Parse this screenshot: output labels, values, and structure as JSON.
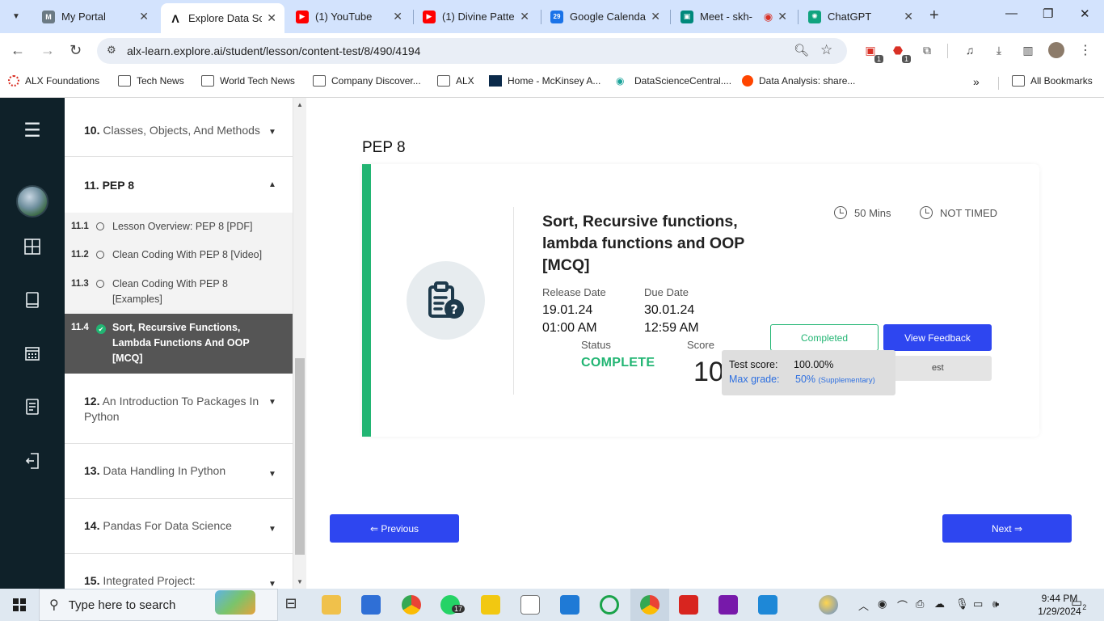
{
  "browser": {
    "tabs": [
      {
        "title": "My Portal",
        "active": false
      },
      {
        "title": "Explore Data Sci",
        "active": true
      },
      {
        "title": "(1) YouTube",
        "active": false
      },
      {
        "title": "(1) Divine Patter",
        "active": false
      },
      {
        "title": "Google Calenda",
        "active": false
      },
      {
        "title": "Meet - skh-",
        "active": false
      },
      {
        "title": "ChatGPT",
        "active": false
      }
    ],
    "url": "alx-learn.explore.ai/student/lesson/content-test/8/490/4194",
    "extension_badges": [
      "1",
      "1"
    ],
    "bookmarks": [
      "ALX Foundations",
      "Tech News",
      "World Tech News",
      "Company Discover...",
      "ALX",
      "Home - McKinsey A...",
      "DataScienceCentral....",
      "Data Analysis: share...",
      "All Bookmarks"
    ]
  },
  "sidebar": {
    "modules": [
      {
        "num": "10.",
        "title": "Classes, Objects, And Methods"
      },
      {
        "num": "11.",
        "title": "PEP 8"
      },
      {
        "num": "12.",
        "title": "An Introduction To Packages In",
        "title2": "Python"
      },
      {
        "num": "13.",
        "title": "Data Handling In Python"
      },
      {
        "num": "14.",
        "title": "Pandas For Data Science"
      },
      {
        "num": "15.",
        "title": "Integrated Project:"
      }
    ],
    "lessons": [
      {
        "num": "11.1",
        "title": "Lesson Overview: PEP 8 [PDF]"
      },
      {
        "num": "11.2",
        "title": "Clean Coding With PEP 8 [Video]"
      },
      {
        "num": "11.3",
        "title": "Clean Coding With PEP 8",
        "title2": "[Examples]"
      },
      {
        "num": "11.4",
        "title": "Sort, Recursive Functions,",
        "title2": "Lambda Functions And OOP",
        "title3": "[MCQ]"
      }
    ]
  },
  "main": {
    "page_title": "PEP 8",
    "quiz": {
      "title": "Sort, Recursive functions, lambda functions and OOP [MCQ]",
      "duration": "50 Mins",
      "timing": "NOT TIMED",
      "release_label": "Release Date",
      "release_date": "19.01.24",
      "release_time": "01:00 AM",
      "due_label": "Due Date",
      "due_date": "30.01.24",
      "due_time": "12:59 AM",
      "status_label": "Status",
      "status_value": "COMPLETE",
      "score_label": "Score",
      "score_value": "10",
      "completed_button": "Completed",
      "feedback_button": "View Feedback",
      "retake_button_partial": "est"
    },
    "tooltip": {
      "test_score_label": "Test score:",
      "test_score_value": "100.00%",
      "max_grade_label": "Max grade:",
      "max_grade_value": "50%",
      "max_grade_note": "(Supplementary)"
    },
    "prev_button": "⇐ Previous",
    "next_button": "Next ⇒"
  },
  "taskbar": {
    "search_placeholder": "Type here to search",
    "whatsapp_badge": "17",
    "time": "9:44 PM",
    "date": "1/29/2024",
    "notifications": "2"
  },
  "colors": {
    "accent_blue": "#2e46f0",
    "success_green": "#22b573",
    "nav_dark": "#0f2129"
  }
}
